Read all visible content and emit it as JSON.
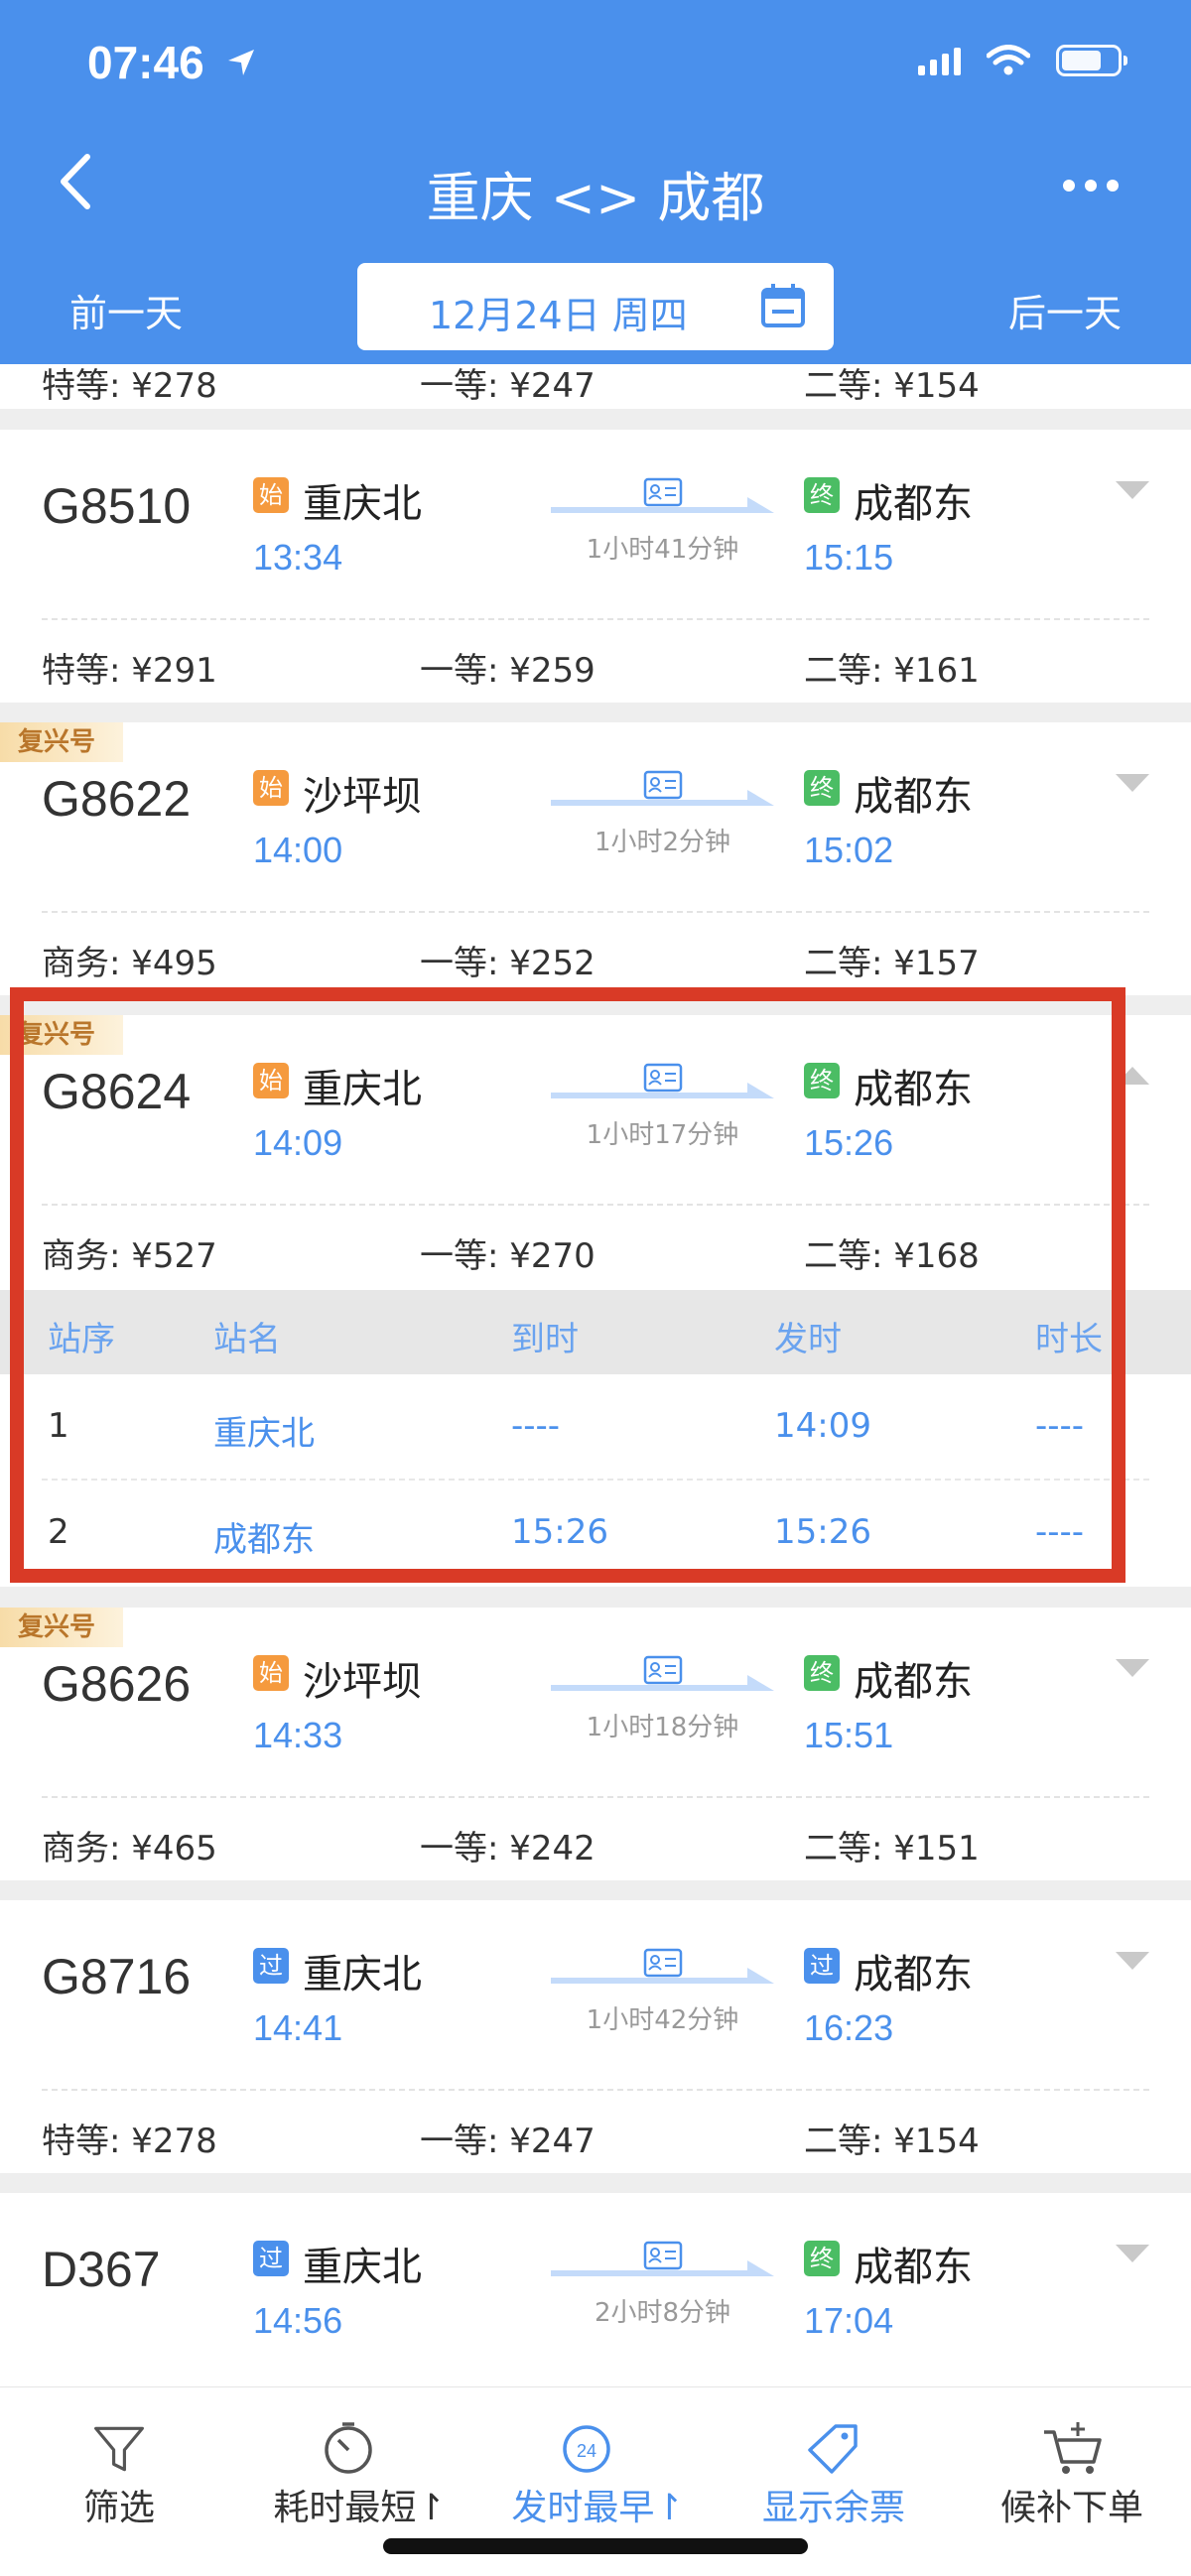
{
  "status_bar": {
    "time": "07:46"
  },
  "nav": {
    "title": "重庆 <> 成都",
    "prev_day": "前一天",
    "next_day": "后一天",
    "date": "12月24日 周四"
  },
  "partial_top_prices": {
    "p1": "特等: ¥278",
    "p2": "一等: ¥247",
    "p3": "二等: ¥154"
  },
  "trains": [
    {
      "no": "G8510",
      "badge": "",
      "from_tag": "始",
      "from": "重庆北",
      "dep": "13:34",
      "duration": "1小时41分钟",
      "to_tag": "终",
      "to": "成都东",
      "arr": "15:15",
      "prices": [
        "特等: ¥291",
        "一等: ¥259",
        "二等: ¥161"
      ]
    },
    {
      "no": "G8622",
      "badge": "复兴号",
      "from_tag": "始",
      "from": "沙坪坝",
      "dep": "14:00",
      "duration": "1小时2分钟",
      "to_tag": "终",
      "to": "成都东",
      "arr": "15:02",
      "prices": [
        "商务: ¥495",
        "一等: ¥252",
        "二等: ¥157"
      ]
    },
    {
      "no": "G8624",
      "badge": "复兴号",
      "from_tag": "始",
      "from": "重庆北",
      "dep": "14:09",
      "duration": "1小时17分钟",
      "to_tag": "终",
      "to": "成都东",
      "arr": "15:26",
      "prices": [
        "商务: ¥527",
        "一等: ¥270",
        "二等: ¥168"
      ]
    },
    {
      "no": "G8626",
      "badge": "复兴号",
      "from_tag": "始",
      "from": "沙坪坝",
      "dep": "14:33",
      "duration": "1小时18分钟",
      "to_tag": "终",
      "to": "成都东",
      "arr": "15:51",
      "prices": [
        "商务: ¥465",
        "一等: ¥242",
        "二等: ¥151"
      ]
    },
    {
      "no": "G8716",
      "badge": "",
      "from_tag": "过",
      "from": "重庆北",
      "dep": "14:41",
      "duration": "1小时42分钟",
      "to_tag": "过",
      "to": "成都东",
      "arr": "16:23",
      "prices": [
        "特等: ¥278",
        "一等: ¥247",
        "二等: ¥154"
      ]
    },
    {
      "no": "D367",
      "badge": "",
      "from_tag": "过",
      "from": "重庆北",
      "dep": "14:56",
      "duration": "2小时8分钟",
      "to_tag": "终",
      "to": "成都东",
      "arr": "17:04",
      "prices": []
    }
  ],
  "stops": {
    "headers": [
      "站序",
      "站名",
      "到时",
      "发时",
      "时长"
    ],
    "rows": [
      [
        "1",
        "重庆北",
        "----",
        "14:09",
        "----"
      ],
      [
        "2",
        "成都东",
        "15:26",
        "15:26",
        "----"
      ]
    ]
  },
  "tabs": [
    {
      "label": "筛选",
      "icon": "filter-icon"
    },
    {
      "label": "耗时最短↾",
      "icon": "timer-icon"
    },
    {
      "label": "发时最早↾",
      "icon": "clock-24-icon"
    },
    {
      "label": "显示余票",
      "icon": "ticket-tag-icon"
    },
    {
      "label": "候补下单",
      "icon": "cart-add-icon"
    }
  ],
  "colors": {
    "brand": "#4a90ec",
    "highlight": "#d93a26",
    "start_tag": "#f59a3e",
    "end_tag": "#4bbd64"
  }
}
